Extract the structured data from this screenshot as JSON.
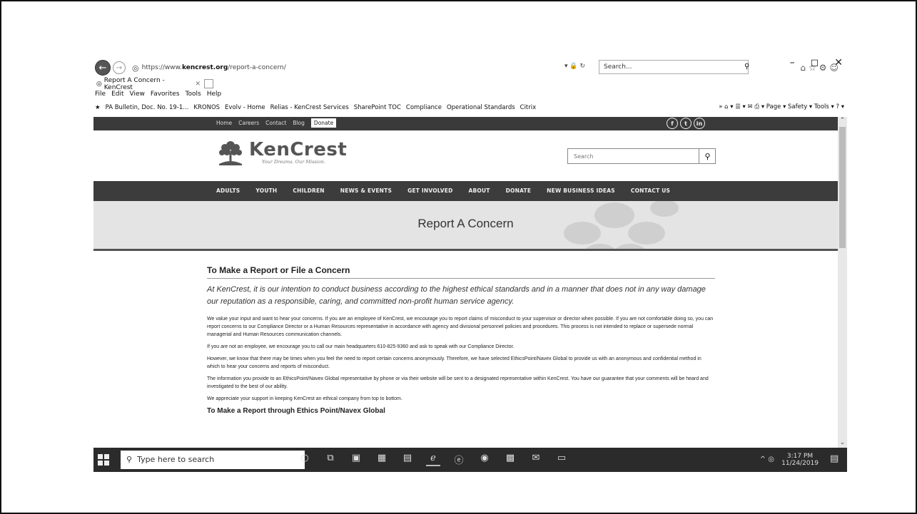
{
  "browser": {
    "window_controls": [
      "–",
      "◻",
      "✕"
    ],
    "url_prefix": "https://www.",
    "url_domain": "kencrest.org",
    "url_path": "/report-a-concern/",
    "search_placeholder": "Search...",
    "tab_title": "Report A Concern - KenCrest",
    "menu": [
      "File",
      "Edit",
      "View",
      "Favorites",
      "Tools",
      "Help"
    ],
    "favorites": [
      "PA Bulletin, Doc. No. 19-1...",
      "KRONOS",
      "Evolv - Home",
      "Relias - KenCrest Services",
      "SharePoint TOC",
      "Compliance",
      "Operational Standards",
      "Citrix"
    ],
    "fav_tools": "»   ⌂ ▾  ☰ ▾  ✉  ⎙ ▾  Page ▾   Safety ▾   Tools ▾   ? ▾"
  },
  "site": {
    "topnav": [
      "Home",
      "Careers",
      "Contact",
      "Blog"
    ],
    "donate_label": "Donate",
    "social": [
      "f",
      "t",
      "in"
    ],
    "logo_name": "KenCrest",
    "logo_tagline": "Your Dreams. Our Mission.",
    "search_placeholder": "Search",
    "mainnav": [
      "ADULTS",
      "YOUTH",
      "CHILDREN",
      "NEWS & EVENTS",
      "GET INVOLVED",
      "ABOUT",
      "DONATE",
      "NEW BUSINESS IDEAS",
      "CONTACT US"
    ],
    "banner_title": "Report A Concern"
  },
  "content": {
    "heading": "To Make a Report or File a Concern",
    "lead": "At KenCrest, it is our intention to conduct business according to the highest ethical standards and in a manner that does not in any way damage our reputation as a responsible, caring, and committed non-profit human service agency.",
    "paragraphs": [
      "We value your input and want to hear your concerns. If you are an employee of KenCrest, we encourage you to report claims of misconduct to your supervisor or director when possible. If you are not comfortable doing so, you can report concerns to our Compliance Director or a Human Resources representative in accordance with agency and divisional personnel policies and procedures. This process is not intended to replace or supersede normal managerial and Human Resources communication channels.",
      "If you are not an employee, we encourage you to call our main headquarters 610-825-9360 and ask to speak with our Compliance Director.",
      "However, we know that there may be times when you feel the need to report certain concerns anonymously. Therefore, we have selected EthicsPoint/Navex Global to provide us with an anonymous and confidential method in which to hear your concerns and reports of misconduct.",
      "The information you provide to an EthicsPoint/Navex Global representative by phone or via their website will be sent to a designated representative within KenCrest. You have our guarantee that your comments will be heard and investigated to the best of our ability.",
      "We appreciate your support in keeping KenCrest an ethical company from top to bottom."
    ],
    "subheading": "To Make a Report through Ethics Point/Navex Global"
  },
  "taskbar": {
    "search_placeholder": "Type here to search",
    "time": "3:17 PM",
    "date": "11/24/2019"
  }
}
